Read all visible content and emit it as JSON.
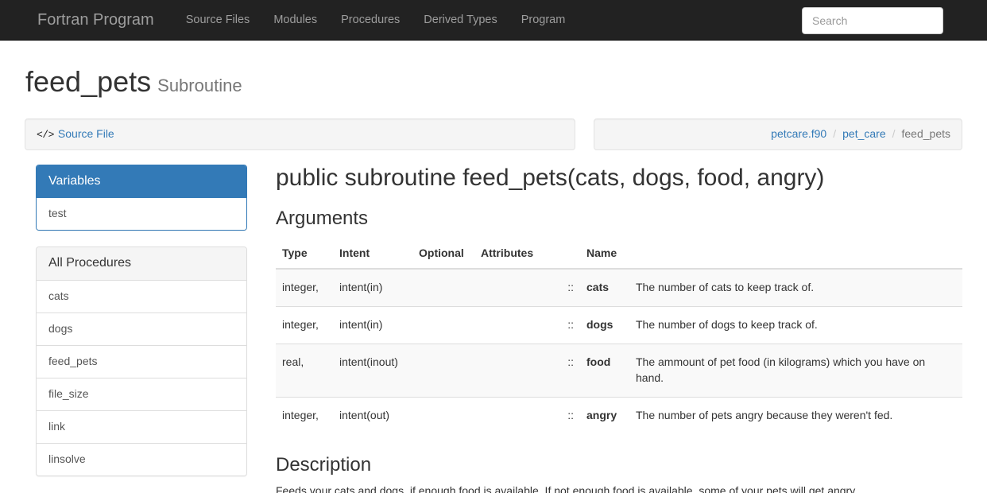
{
  "navbar": {
    "brand": "Fortran Program",
    "links": [
      {
        "label": "Source Files"
      },
      {
        "label": "Modules"
      },
      {
        "label": "Procedures"
      },
      {
        "label": "Derived Types"
      },
      {
        "label": "Program"
      }
    ],
    "search": {
      "placeholder": "Search",
      "value": ""
    }
  },
  "page": {
    "title": "feed_pets",
    "subtitle": "Subroutine"
  },
  "source_file_well": {
    "icon": "code-icon",
    "label": "Source File"
  },
  "breadcrumb": {
    "items": [
      {
        "label": "petcare.f90",
        "active": false
      },
      {
        "label": "pet_care",
        "active": false
      },
      {
        "label": "feed_pets",
        "active": true
      }
    ],
    "separator": "/"
  },
  "sidebar": {
    "variables_panel": {
      "title": "Variables",
      "items": [
        {
          "label": "test"
        }
      ]
    },
    "procedures_panel": {
      "title": "All Procedures",
      "items": [
        {
          "label": "cats"
        },
        {
          "label": "dogs"
        },
        {
          "label": "feed_pets"
        },
        {
          "label": "file_size"
        },
        {
          "label": "link"
        },
        {
          "label": "linsolve"
        }
      ]
    }
  },
  "main": {
    "signature": "public subroutine feed_pets(cats, dogs, food, angry)",
    "arguments_heading": "Arguments",
    "table": {
      "headers": [
        "Type",
        "Intent",
        "Optional",
        "Attributes",
        "",
        "Name",
        ""
      ],
      "rows": [
        {
          "type": "integer,",
          "intent": "intent(in)",
          "optional": "",
          "attributes": "",
          "sep": "::",
          "name": "cats",
          "description": "The number of cats to keep track of."
        },
        {
          "type": "integer,",
          "intent": "intent(in)",
          "optional": "",
          "attributes": "",
          "sep": "::",
          "name": "dogs",
          "description": "The number of dogs to keep track of."
        },
        {
          "type": "real,",
          "intent": "intent(inout)",
          "optional": "",
          "attributes": "",
          "sep": "::",
          "name": "food",
          "description": "The ammount of pet food (in kilograms) which you have on hand."
        },
        {
          "type": "integer,",
          "intent": "intent(out)",
          "optional": "",
          "attributes": "",
          "sep": "::",
          "name": "angry",
          "description": "The number of pets angry because they weren't fed."
        }
      ]
    },
    "description_heading": "Description",
    "description_text": "Feeds your cats and dogs, if enough food is available. If not enough food is available, some of your pets will get angry."
  },
  "colors": {
    "navbar_bg": "#222222",
    "navbar_text": "#9d9d9d",
    "primary": "#337ab7",
    "link": "#337ab7",
    "well_bg": "#f5f5f5",
    "muted": "#777777",
    "stripe": "#f9f9f9"
  }
}
